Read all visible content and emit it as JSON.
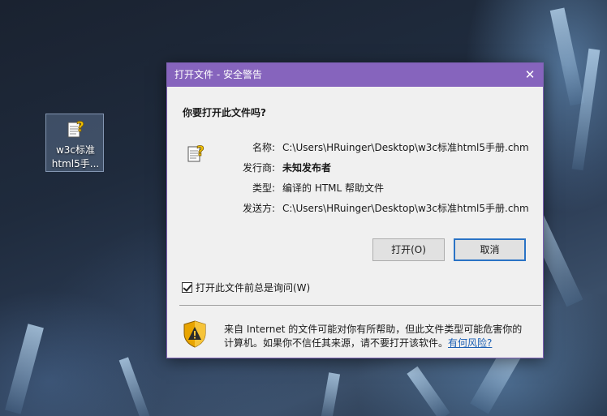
{
  "desktop": {
    "icon": {
      "name": "help-file-icon",
      "label_line1": "w3c标准",
      "label_line2": "html5手..."
    }
  },
  "dialog": {
    "title": "打开文件 - 安全警告",
    "close_symbol": "✕",
    "question": "你要打开此文件吗?",
    "file_icon": "help-file-icon",
    "info": {
      "name_label": "名称:",
      "name_value": "C:\\Users\\HRuinger\\Desktop\\w3c标准html5手册.chm",
      "publisher_label": "发行商:",
      "publisher_value": "未知发布者",
      "type_label": "类型:",
      "type_value": "编译的 HTML 帮助文件",
      "from_label": "发送方:",
      "from_value": "C:\\Users\\HRuinger\\Desktop\\w3c标准html5手册.chm"
    },
    "buttons": {
      "open_label": "打开(O)",
      "cancel_label": "取消"
    },
    "checkbox": {
      "label": "打开此文件前总是询问(W)",
      "checked": true
    },
    "warning": {
      "icon": "shield-warning-icon",
      "text_line1": "来自 Internet 的文件可能对你有所帮助，但此文件类型可能危害你的",
      "text_line2": "计算机。如果你不信任其来源，请不要打开该软件。",
      "link": "有何风险?"
    },
    "colors": {
      "titlebar": "#8664bd",
      "default_button_border": "#2a73c5",
      "link": "#1a5fb4"
    }
  }
}
